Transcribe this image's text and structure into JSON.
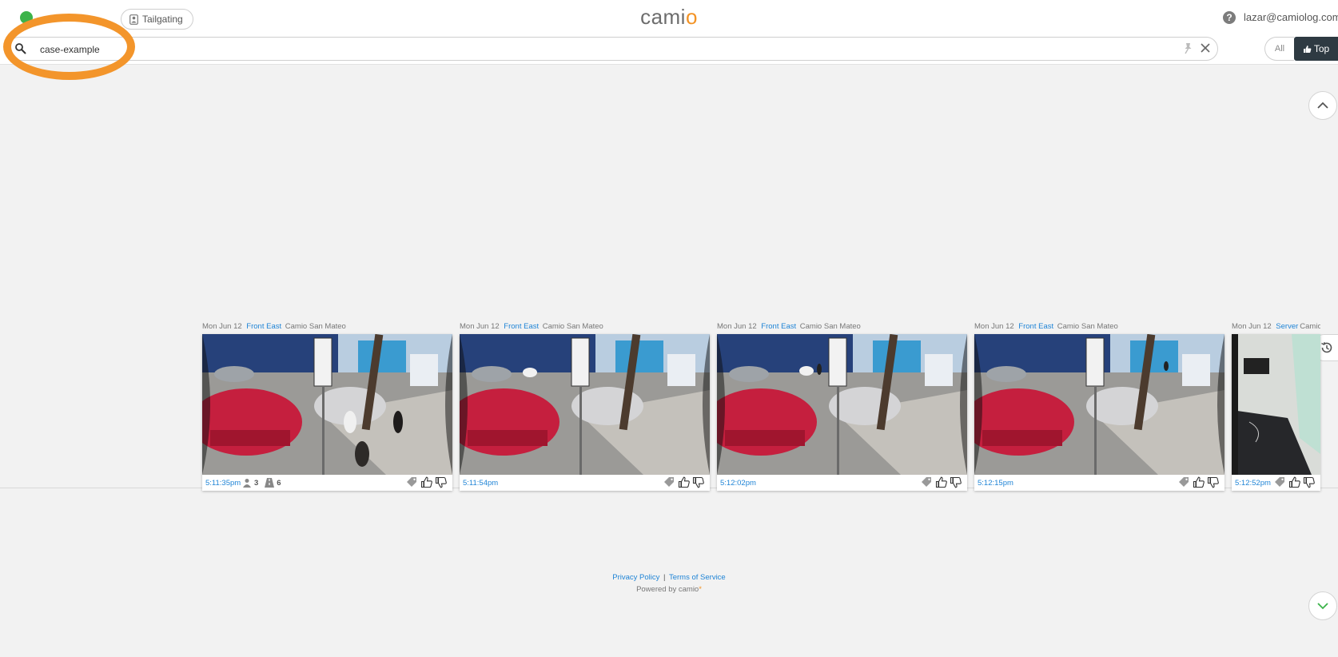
{
  "header": {
    "tag_chip": "Tailgating",
    "logo_main": "cami",
    "logo_accent": "o",
    "help": "?",
    "user_email": "lazar@camiolog.com"
  },
  "search": {
    "query": "case-example"
  },
  "toggle": {
    "all_label": "All",
    "top_label": "Top"
  },
  "clips": [
    {
      "date": "Mon Jun 12",
      "camera": "Front East",
      "location": "Camio San Mateo",
      "time": "5:11:35pm",
      "people": "3",
      "vehicles": "6",
      "scene": "street"
    },
    {
      "date": "Mon Jun 12",
      "camera": "Front East",
      "location": "Camio San Mateo",
      "time": "5:11:54pm",
      "scene": "street"
    },
    {
      "date": "Mon Jun 12",
      "camera": "Front East",
      "location": "Camio San Mateo",
      "time": "5:12:02pm",
      "scene": "street"
    },
    {
      "date": "Mon Jun 12",
      "camera": "Front East",
      "location": "Camio San Mateo",
      "time": "5:12:15pm",
      "scene": "street"
    },
    {
      "date": "Mon Jun 12",
      "camera": "Server",
      "location": "Camio S",
      "time": "5:12:52pm",
      "scene": "server-room"
    }
  ],
  "footer": {
    "privacy": "Privacy Policy",
    "separator": "|",
    "terms": "Terms of Service",
    "powered_prefix": "Powered by camio",
    "powered_mark": "*"
  },
  "colors": {
    "accent_orange": "#f39325",
    "link_blue": "#1f84d6",
    "dark_toggle": "#2e3a42",
    "status_green": "#3cb34a"
  }
}
